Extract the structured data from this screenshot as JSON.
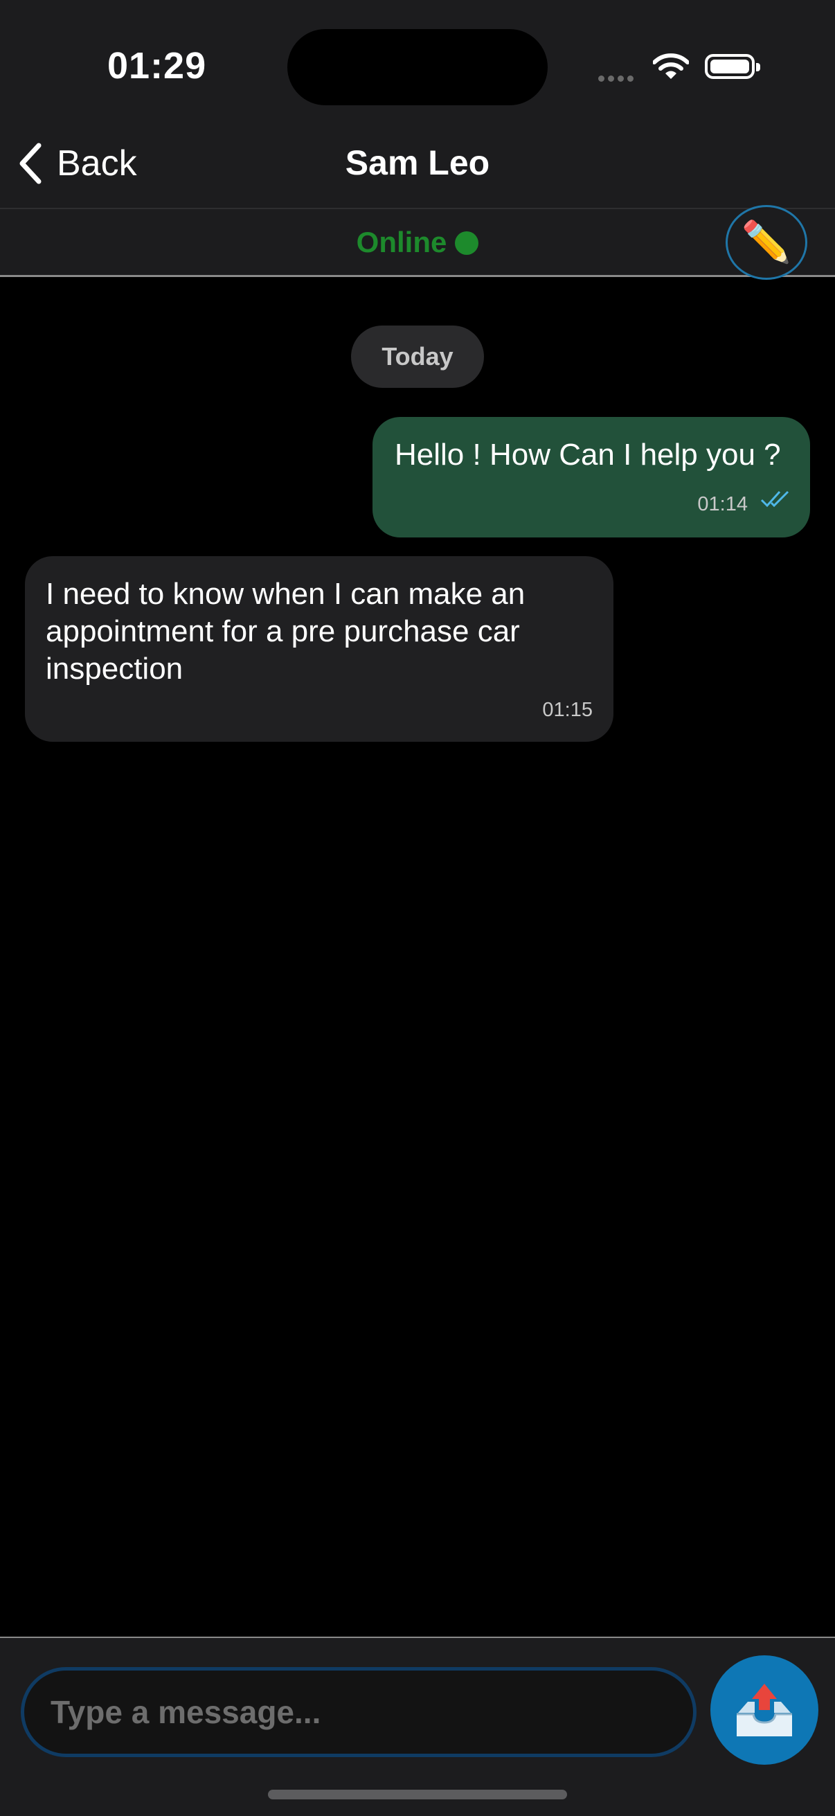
{
  "status_bar": {
    "time": "01:29"
  },
  "nav": {
    "back_label": "Back",
    "title": "Sam Leo"
  },
  "presence": {
    "status": "Online",
    "status_color": "#1d8a2c",
    "edit_icon": "pencil-icon"
  },
  "chat": {
    "date_separator": "Today",
    "messages": [
      {
        "direction": "outgoing",
        "text": "Hello ! How Can I help you ?",
        "time": "01:14",
        "read": true
      },
      {
        "direction": "incoming",
        "text": "I need to know when I can make an appointment for a pre purchase car inspection",
        "time": "01:15"
      }
    ]
  },
  "composer": {
    "placeholder": "Type a message...",
    "send_icon": "outbox-tray-icon"
  },
  "colors": {
    "outgoing_bubble": "#22513a",
    "incoming_bubble": "#202022",
    "accent": "#0e77b5"
  }
}
